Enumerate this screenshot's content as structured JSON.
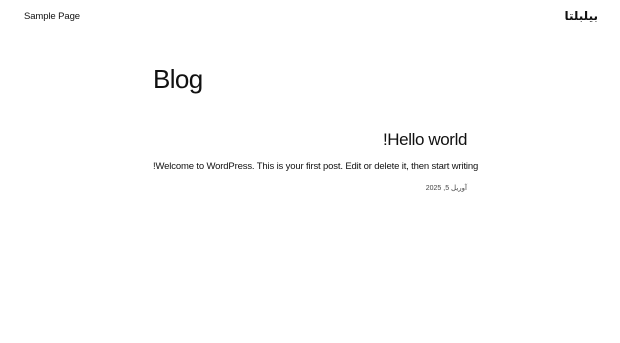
{
  "header": {
    "nav_link": "Sample Page",
    "site_title": "بیلبلتا"
  },
  "main": {
    "heading": "Blog",
    "posts": [
      {
        "title": "!Hello world",
        "excerpt": "!Welcome to WordPress. This is your first post. Edit or delete it, then start writing",
        "date": "آوریل 5, 2025"
      }
    ]
  },
  "colors": {
    "background": "#ffffff",
    "text": "#111111",
    "muted_text": "#444444"
  }
}
